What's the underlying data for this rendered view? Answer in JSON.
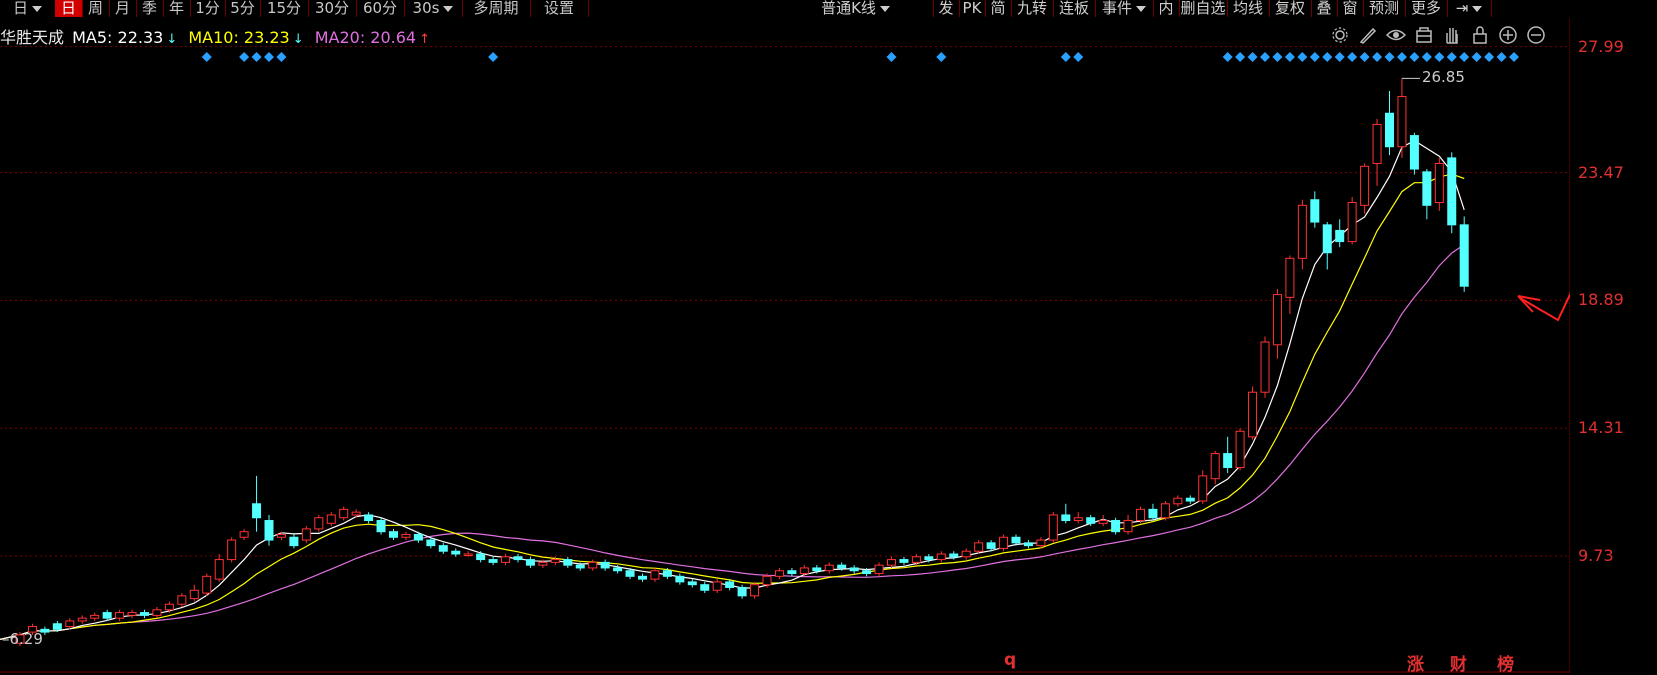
{
  "toolbar": {
    "items": [
      {
        "label": "日",
        "type": "dropdown"
      },
      {
        "label": "日",
        "active": true
      },
      {
        "label": "周"
      },
      {
        "label": "月"
      },
      {
        "label": "季"
      },
      {
        "label": "年"
      },
      {
        "label": "1分"
      },
      {
        "label": "5分"
      },
      {
        "label": "15分"
      },
      {
        "label": "30分"
      },
      {
        "label": "60分"
      },
      {
        "label": "30s",
        "type": "dropdown"
      },
      {
        "label": "多周期"
      },
      {
        "label": "设置"
      }
    ],
    "right_items": [
      {
        "label": "普通K线",
        "type": "dropdown"
      },
      {
        "label": "发"
      },
      {
        "label": "PK"
      },
      {
        "label": "简"
      },
      {
        "label": "九转"
      },
      {
        "label": "连板"
      },
      {
        "label": "事件",
        "type": "dropdown"
      },
      {
        "label": "内"
      },
      {
        "label": "删自选"
      },
      {
        "label": "均线"
      },
      {
        "label": "复权"
      },
      {
        "label": "叠"
      },
      {
        "label": "窗"
      },
      {
        "label": "预测"
      },
      {
        "label": "更多"
      },
      {
        "label": "⇥",
        "type": "dropdown"
      }
    ]
  },
  "info": {
    "stock_name": "华胜天成",
    "ma5_label": "MA5: 22.33",
    "ma5_arrow": "↓",
    "ma5_color": "#ffffff",
    "ma10_label": "MA10: 23.23",
    "ma10_arrow": "↓",
    "ma10_color": "#ffff00",
    "ma20_label": "MA20: 20.64",
    "ma20_arrow": "↑",
    "ma20_color": "#e070e0"
  },
  "tool_icons": [
    "settings-icon",
    "pen-icon",
    "eye-icon",
    "save-icon",
    "hand-icon",
    "lock-icon",
    "zoom-in-icon",
    "zoom-out-icon"
  ],
  "price_axis": {
    "labels": [
      "27.99",
      "23.47",
      "18.89",
      "14.31",
      "9.73"
    ]
  },
  "chart_labels": {
    "max_price": "26.85",
    "min_price": "6.29"
  },
  "bottom_tags": {
    "q": "q",
    "zhang": "涨",
    "cai": "财",
    "bang": "榜"
  },
  "colors": {
    "up": "#ff3232",
    "down": "#54ffff",
    "grid": "#7a0000",
    "ma5": "#ffffff",
    "ma10": "#ffff00",
    "ma20": "#e070e0",
    "event": "#2aa0ff"
  },
  "chart_data": {
    "type": "candlestick",
    "ylim": [
      6.0,
      28.8
    ],
    "grid_values": [
      27.99,
      23.47,
      18.89,
      14.31,
      9.73
    ],
    "candles": [
      [
        6.6,
        6.9,
        6.5,
        7.0
      ],
      [
        7.0,
        7.2,
        6.9,
        7.3
      ],
      [
        7.1,
        7.0,
        6.9,
        7.2
      ],
      [
        7.3,
        7.1,
        7.0,
        7.4
      ],
      [
        7.2,
        7.4,
        7.1,
        7.5
      ],
      [
        7.4,
        7.5,
        7.3,
        7.6
      ],
      [
        7.5,
        7.6,
        7.4,
        7.7
      ],
      [
        7.7,
        7.5,
        7.4,
        7.8
      ],
      [
        7.5,
        7.7,
        7.4,
        7.8
      ],
      [
        7.6,
        7.7,
        7.5,
        7.8
      ],
      [
        7.7,
        7.6,
        7.5,
        7.8
      ],
      [
        7.6,
        7.8,
        7.5,
        7.9
      ],
      [
        7.8,
        8.0,
        7.7,
        8.1
      ],
      [
        8.0,
        8.3,
        7.9,
        8.4
      ],
      [
        8.2,
        8.5,
        8.1,
        8.7
      ],
      [
        8.4,
        9.0,
        8.3,
        9.1
      ],
      [
        8.9,
        9.6,
        8.8,
        9.8
      ],
      [
        9.6,
        10.3,
        9.5,
        10.4
      ],
      [
        10.4,
        10.6,
        10.3,
        10.7
      ],
      [
        11.6,
        11.1,
        10.6,
        12.6
      ],
      [
        11.0,
        10.3,
        10.1,
        11.2
      ],
      [
        10.4,
        10.5,
        10.3,
        10.6
      ],
      [
        10.4,
        10.1,
        10.0,
        10.5
      ],
      [
        10.3,
        10.7,
        10.2,
        10.8
      ],
      [
        10.7,
        11.1,
        10.6,
        11.2
      ],
      [
        10.9,
        11.2,
        10.8,
        11.3
      ],
      [
        11.1,
        11.4,
        11.0,
        11.5
      ],
      [
        11.2,
        11.3,
        11.1,
        11.4
      ],
      [
        11.2,
        11.0,
        10.9,
        11.3
      ],
      [
        11.0,
        10.6,
        10.5,
        11.1
      ],
      [
        10.6,
        10.4,
        10.3,
        10.7
      ],
      [
        10.4,
        10.5,
        10.3,
        10.6
      ],
      [
        10.5,
        10.3,
        10.2,
        10.6
      ],
      [
        10.3,
        10.1,
        10.0,
        10.4
      ],
      [
        10.1,
        9.9,
        9.8,
        10.2
      ],
      [
        9.9,
        9.8,
        9.7,
        10.0
      ],
      [
        9.8,
        9.8,
        9.7,
        9.9
      ],
      [
        9.8,
        9.6,
        9.5,
        9.9
      ],
      [
        9.6,
        9.5,
        9.4,
        9.7
      ],
      [
        9.5,
        9.7,
        9.4,
        9.8
      ],
      [
        9.7,
        9.6,
        9.5,
        9.8
      ],
      [
        9.6,
        9.4,
        9.3,
        9.7
      ],
      [
        9.4,
        9.5,
        9.3,
        9.6
      ],
      [
        9.5,
        9.6,
        9.4,
        9.7
      ],
      [
        9.6,
        9.4,
        9.3,
        9.7
      ],
      [
        9.4,
        9.3,
        9.2,
        9.5
      ],
      [
        9.3,
        9.5,
        9.2,
        9.6
      ],
      [
        9.5,
        9.3,
        9.2,
        9.6
      ],
      [
        9.3,
        9.2,
        9.1,
        9.4
      ],
      [
        9.2,
        9.0,
        8.9,
        9.3
      ],
      [
        9.0,
        8.9,
        8.8,
        9.1
      ],
      [
        8.9,
        9.2,
        8.8,
        9.3
      ],
      [
        9.2,
        9.0,
        8.9,
        9.3
      ],
      [
        9.0,
        8.8,
        8.7,
        9.1
      ],
      [
        8.8,
        8.7,
        8.6,
        8.9
      ],
      [
        8.7,
        8.5,
        8.4,
        8.8
      ],
      [
        8.5,
        8.8,
        8.4,
        8.9
      ],
      [
        8.8,
        8.6,
        8.5,
        8.9
      ],
      [
        8.6,
        8.3,
        8.2,
        8.7
      ],
      [
        8.3,
        8.7,
        8.2,
        8.8
      ],
      [
        8.7,
        9.0,
        8.6,
        9.1
      ],
      [
        9.0,
        9.2,
        8.9,
        9.3
      ],
      [
        9.2,
        9.1,
        9.0,
        9.3
      ],
      [
        9.1,
        9.3,
        9.0,
        9.4
      ],
      [
        9.3,
        9.2,
        9.1,
        9.4
      ],
      [
        9.2,
        9.4,
        9.1,
        9.5
      ],
      [
        9.4,
        9.3,
        9.2,
        9.5
      ],
      [
        9.3,
        9.2,
        9.1,
        9.4
      ],
      [
        9.2,
        9.1,
        9.0,
        9.3
      ],
      [
        9.1,
        9.4,
        9.0,
        9.5
      ],
      [
        9.4,
        9.6,
        9.3,
        9.7
      ],
      [
        9.6,
        9.5,
        9.4,
        9.7
      ],
      [
        9.5,
        9.7,
        9.4,
        9.8
      ],
      [
        9.7,
        9.6,
        9.5,
        9.8
      ],
      [
        9.6,
        9.8,
        9.5,
        9.9
      ],
      [
        9.8,
        9.7,
        9.6,
        9.9
      ],
      [
        9.7,
        9.9,
        9.6,
        10.0
      ],
      [
        9.9,
        10.2,
        9.8,
        10.3
      ],
      [
        10.2,
        10.0,
        9.9,
        10.3
      ],
      [
        10.0,
        10.4,
        9.9,
        10.5
      ],
      [
        10.4,
        10.2,
        10.1,
        10.5
      ],
      [
        10.2,
        10.1,
        10.0,
        10.3
      ],
      [
        10.1,
        10.3,
        10.0,
        10.4
      ],
      [
        10.3,
        11.2,
        10.2,
        11.3
      ],
      [
        11.2,
        11.0,
        10.9,
        11.6
      ],
      [
        11.0,
        11.1,
        10.9,
        11.3
      ],
      [
        11.1,
        10.9,
        10.8,
        11.2
      ],
      [
        10.9,
        11.0,
        10.8,
        11.2
      ],
      [
        11.0,
        10.6,
        10.5,
        11.1
      ],
      [
        10.6,
        11.0,
        10.5,
        11.2
      ],
      [
        11.0,
        11.4,
        10.9,
        11.5
      ],
      [
        11.4,
        11.1,
        11.0,
        11.6
      ],
      [
        11.1,
        11.6,
        11.0,
        11.7
      ],
      [
        11.6,
        11.8,
        11.5,
        11.9
      ],
      [
        11.8,
        11.7,
        11.6,
        11.9
      ],
      [
        11.7,
        12.6,
        11.6,
        12.8
      ],
      [
        12.5,
        13.4,
        12.3,
        13.5
      ],
      [
        13.4,
        12.9,
        12.7,
        14.0
      ],
      [
        12.9,
        14.2,
        12.8,
        14.3
      ],
      [
        14.0,
        15.6,
        13.9,
        15.8
      ],
      [
        15.6,
        17.4,
        15.4,
        17.6
      ],
      [
        17.3,
        19.1,
        16.8,
        19.3
      ],
      [
        19.0,
        20.4,
        18.4,
        20.5
      ],
      [
        20.4,
        22.3,
        20.0,
        22.5
      ],
      [
        22.5,
        21.7,
        21.5,
        22.8
      ],
      [
        21.6,
        20.6,
        20.0,
        21.7
      ],
      [
        21.4,
        21.0,
        20.8,
        21.8
      ],
      [
        21.0,
        22.4,
        20.9,
        22.6
      ],
      [
        22.3,
        23.7,
        22.0,
        23.8
      ],
      [
        23.8,
        25.2,
        23.0,
        25.4
      ],
      [
        25.6,
        24.4,
        24.1,
        26.4
      ],
      [
        24.4,
        26.2,
        24.0,
        26.85
      ],
      [
        24.8,
        23.6,
        23.4,
        24.9
      ],
      [
        23.5,
        22.3,
        21.8,
        23.6
      ],
      [
        22.4,
        23.8,
        22.1,
        24.0
      ],
      [
        24.0,
        21.6,
        21.3,
        24.2
      ],
      [
        21.6,
        19.4,
        19.2,
        21.9
      ]
    ],
    "event_markers": [
      15,
      18,
      19,
      20,
      21,
      38,
      70,
      74,
      84,
      85,
      97,
      98,
      99,
      100,
      101,
      102,
      103,
      104,
      105,
      106,
      107,
      108,
      109,
      110,
      111,
      112,
      113,
      114,
      115,
      116,
      117,
      118,
      119,
      120
    ]
  }
}
